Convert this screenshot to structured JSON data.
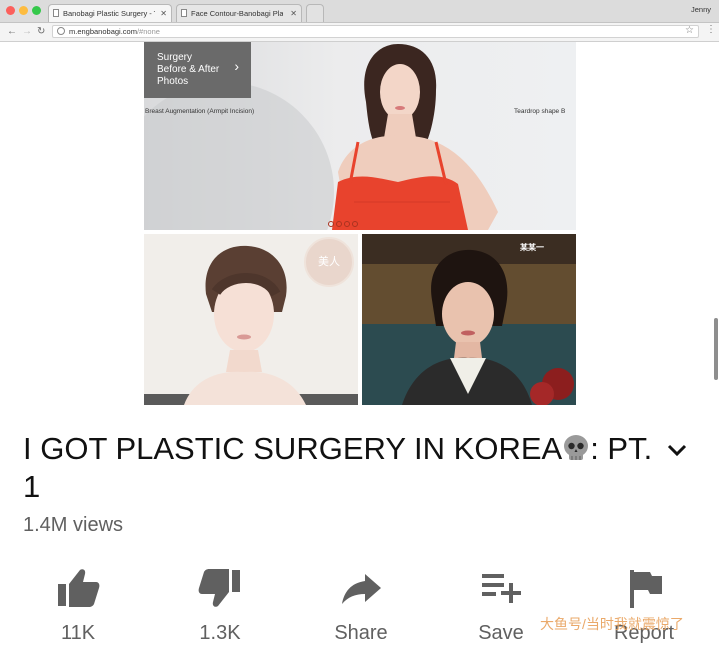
{
  "browser": {
    "tabs": [
      {
        "label": "Banobagi Plastic Surgery - The",
        "active": true
      },
      {
        "label": "Face Contour-Banobagi Plasti",
        "active": false
      }
    ],
    "profile_name": "Jenny",
    "url_host": "m.engbanobagi.com",
    "url_path": "/#none"
  },
  "webpage": {
    "cta_lines": [
      "Surgery",
      "Before & After",
      "Photos"
    ],
    "caption_left": "Breast Augmentation (Armpit Incision)",
    "caption_right": "Teardrop shape B",
    "stamp_text": "美人",
    "corner_mark": "某某一"
  },
  "video": {
    "title": "I GOT PLASTIC SURGERY IN KOREA",
    "title_suffix": ": PT. 1",
    "views": "1.4M views",
    "actions": [
      {
        "name": "like",
        "icon": "thumbs-up-icon",
        "label": "11K"
      },
      {
        "name": "dislike",
        "icon": "thumbs-down-icon",
        "label": "1.3K"
      },
      {
        "name": "share",
        "icon": "share-arrow-icon",
        "label": "Share"
      },
      {
        "name": "save",
        "icon": "playlist-add-icon",
        "label": "Save"
      },
      {
        "name": "report",
        "icon": "flag-icon",
        "label": "Report"
      }
    ]
  },
  "watermark": "大鱼号/当时我就震惊了",
  "colors": {
    "accent_red": "#e8432d",
    "icon_gray": "#606060"
  }
}
